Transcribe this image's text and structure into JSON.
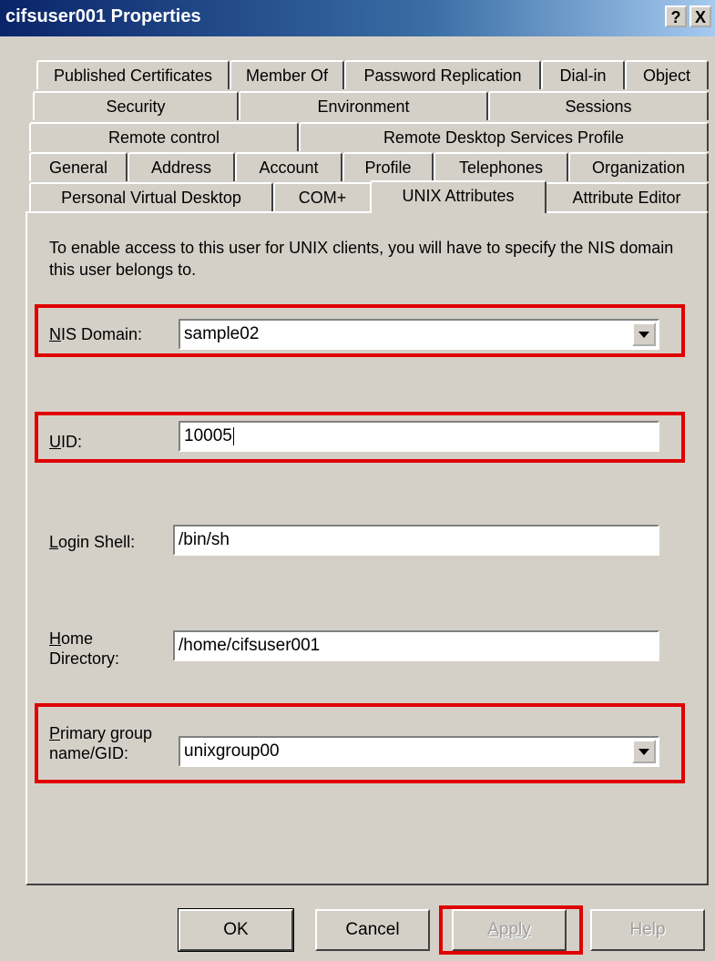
{
  "window": {
    "title": "cifsuser001 Properties",
    "help_glyph": "?",
    "close_glyph": "X"
  },
  "tabs": {
    "row1": [
      "Published Certificates",
      "Member Of",
      "Password Replication",
      "Dial-in",
      "Object"
    ],
    "row2": [
      "Security",
      "Environment",
      "Sessions"
    ],
    "row3": [
      "Remote control",
      "Remote Desktop Services Profile"
    ],
    "row4": [
      "General",
      "Address",
      "Account",
      "Profile",
      "Telephones",
      "Organization"
    ],
    "row5": [
      "Personal Virtual Desktop",
      "COM+",
      "UNIX Attributes",
      "Attribute Editor"
    ],
    "active": "UNIX Attributes"
  },
  "content": {
    "intro": "To enable access to this user for UNIX clients, you will have to specify the NIS domain this user belongs to.",
    "nis_domain": {
      "label_first": "N",
      "label_rest": "IS Domain:",
      "value": "sample02"
    },
    "uid": {
      "label_first": "U",
      "label_rest": "ID:",
      "value": "10005"
    },
    "login_shell": {
      "label_first": "L",
      "label_rest": "ogin Shell:",
      "value": "/bin/sh"
    },
    "home_directory": {
      "label_first": "H",
      "label_rest": "ome",
      "label_line2": "Directory:",
      "value": "/home/cifsuser001"
    },
    "primary_group": {
      "label_first": "P",
      "label_rest": "rimary group",
      "label_line2": "name/GID:",
      "value": "unixgroup00"
    }
  },
  "buttons": {
    "ok": "OK",
    "cancel": "Cancel",
    "apply": "Apply",
    "help": "Help"
  },
  "colors": {
    "highlight": "#e00000",
    "title_bar": "#0a246a",
    "dialog_bg": "#d4d0c8"
  },
  "icons": {
    "dropdown": "chevron-down-icon"
  }
}
